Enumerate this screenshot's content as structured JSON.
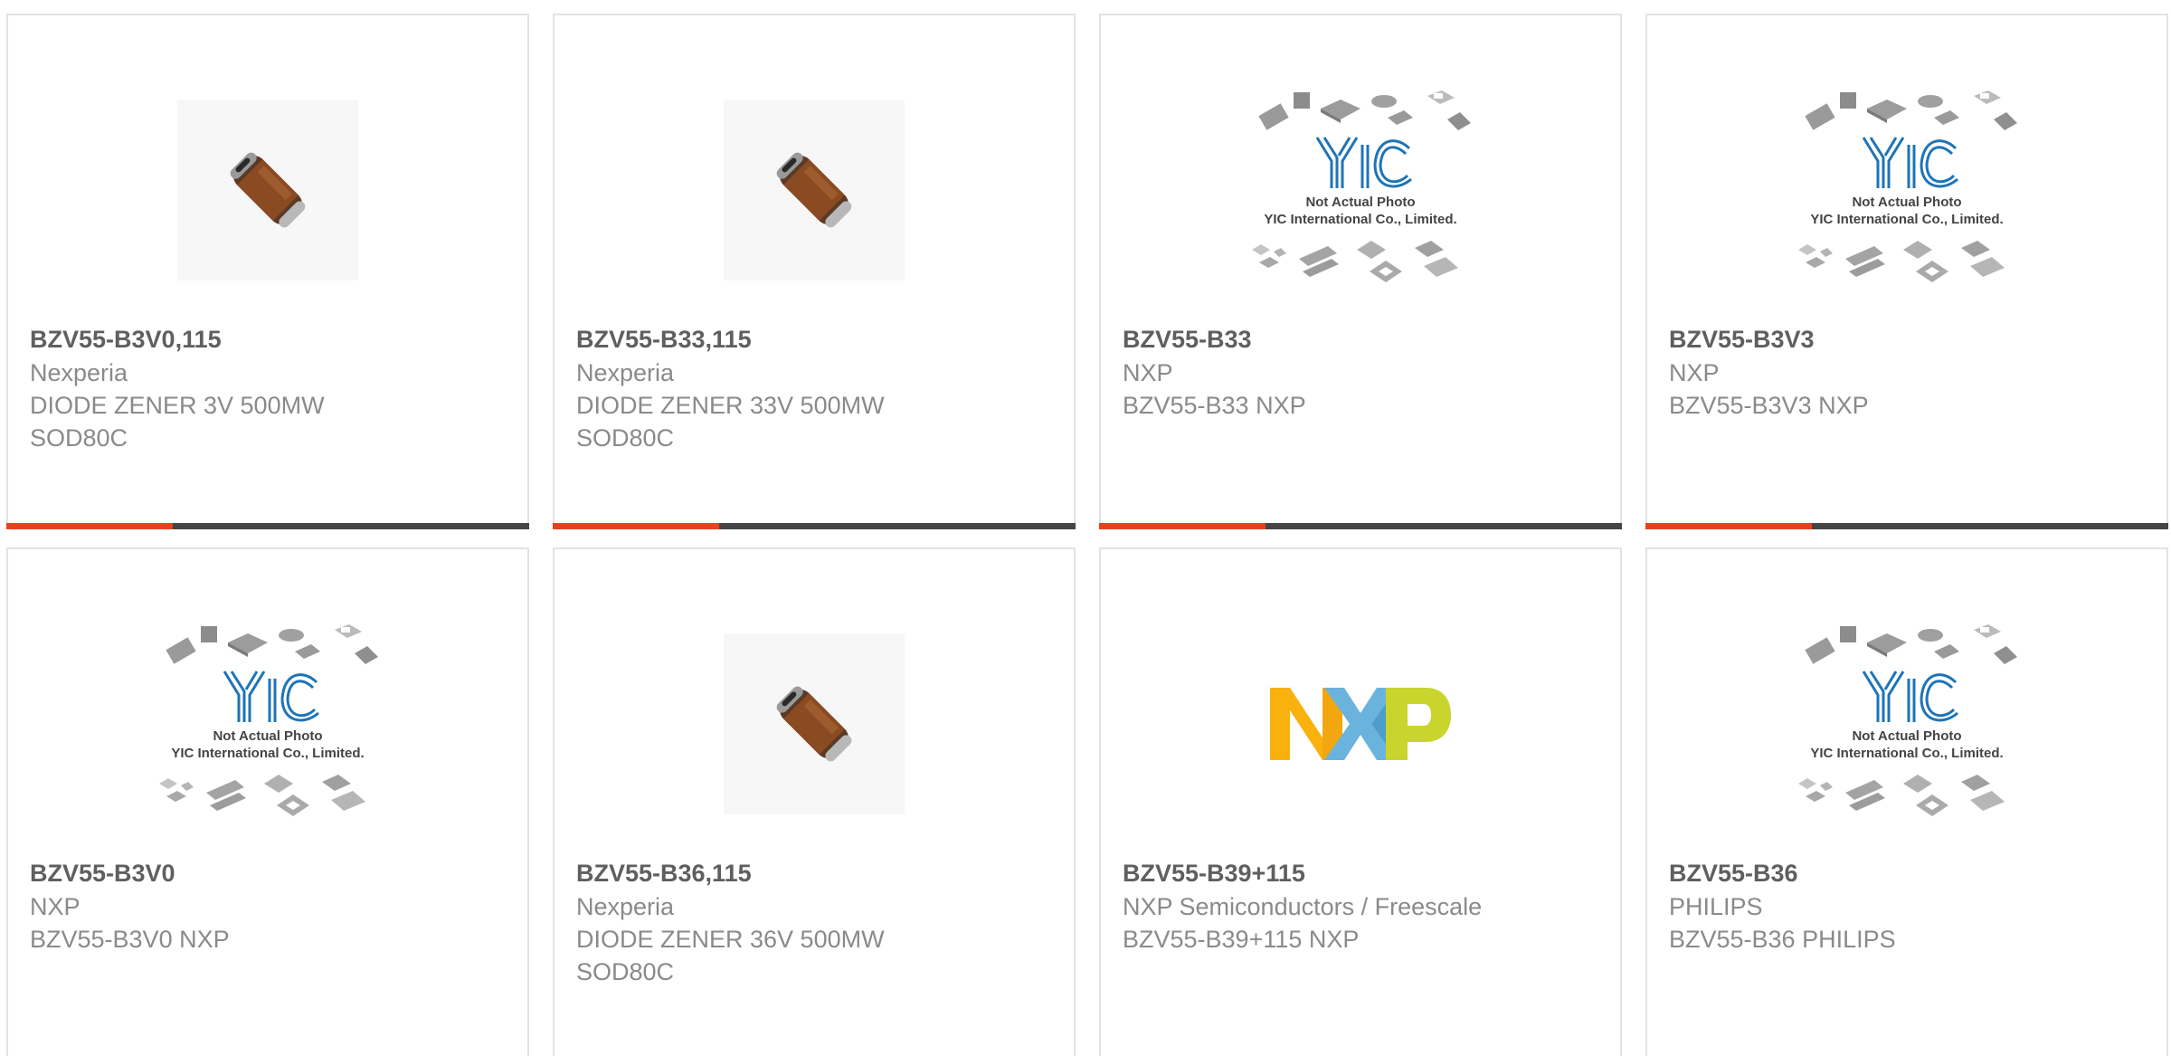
{
  "products": [
    {
      "part_number": "BZV55-B3V0,115",
      "manufacturer": "Nexperia",
      "desc_line1": "DIODE ZENER 3V 500MW",
      "desc_line2": "SOD80C",
      "image_icon": "diode-icon"
    },
    {
      "part_number": "BZV55-B33,115",
      "manufacturer": "Nexperia",
      "desc_line1": "DIODE ZENER 33V 500MW",
      "desc_line2": "SOD80C",
      "image_icon": "diode-icon"
    },
    {
      "part_number": "BZV55-B33",
      "manufacturer": "NXP",
      "desc_line1": "BZV55-B33 NXP",
      "desc_line2": "",
      "image_icon": "yic-placeholder-icon"
    },
    {
      "part_number": "BZV55-B3V3",
      "manufacturer": "NXP",
      "desc_line1": "BZV55-B3V3 NXP",
      "desc_line2": "",
      "image_icon": "yic-placeholder-icon"
    },
    {
      "part_number": "BZV55-B3V0",
      "manufacturer": "NXP",
      "desc_line1": "BZV55-B3V0 NXP",
      "desc_line2": "",
      "image_icon": "yic-placeholder-icon"
    },
    {
      "part_number": "BZV55-B36,115",
      "manufacturer": "Nexperia",
      "desc_line1": "DIODE ZENER 36V 500MW",
      "desc_line2": "SOD80C",
      "image_icon": "diode-icon"
    },
    {
      "part_number": "BZV55-B39+115",
      "manufacturer": "NXP Semiconductors / Freescale",
      "desc_line1": "BZV55-B39+115 NXP",
      "desc_line2": "",
      "image_icon": "nxp-logo-icon"
    },
    {
      "part_number": "BZV55-B36",
      "manufacturer": "PHILIPS",
      "desc_line1": "BZV55-B36 PHILIPS",
      "desc_line2": "",
      "image_icon": "yic-placeholder-icon"
    }
  ],
  "placeholder": {
    "logo_text": "YIC",
    "line1": "Not Actual Photo",
    "line2": "YIC International Co., Limited."
  },
  "colors": {
    "accent": "#e8411b",
    "bar": "#454545",
    "yic_blue": "#1e74b6",
    "nxp_yellow": "#f9b20d",
    "nxp_blue": "#6ab3dd",
    "nxp_green": "#c9d42d"
  }
}
